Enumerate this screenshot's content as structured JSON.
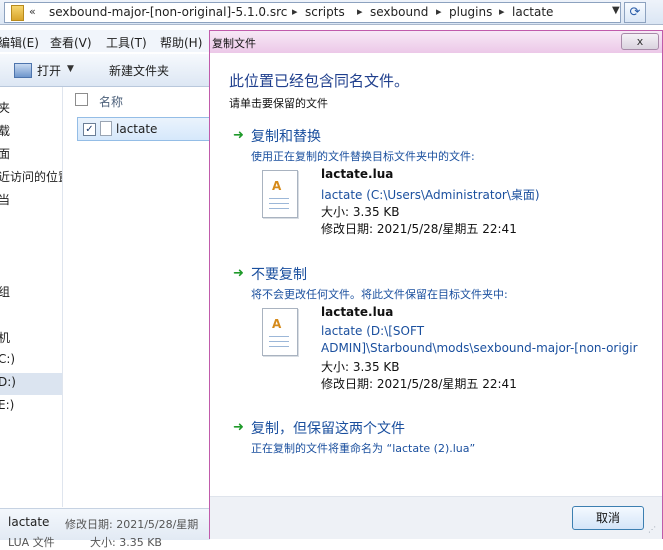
{
  "explorer": {
    "breadcrumbs": [
      "sexbound-major-[non-original]-5.1.0.src",
      "scripts",
      "sexbound",
      "plugins",
      "lactate"
    ],
    "menu": [
      "编辑(E)",
      "查看(V)",
      "工具(T)",
      "帮助(H)"
    ],
    "toolbar": {
      "open_label": "打开",
      "new_folder_label": "新建文件夹"
    },
    "nav_items": [
      "夹",
      "载",
      "面",
      "近访问的位置",
      "当",
      "",
      "",
      "",
      "组",
      "",
      "机",
      "C:)",
      "D:)",
      "E:)"
    ],
    "list_header": "名称",
    "file_row": {
      "name": "lactate",
      "checked": true
    },
    "details": {
      "name": "lactate",
      "date": "修改日期: 2021/5/28/星期",
      "type": "LUA 文件",
      "size": "大小: 3.35 KB"
    }
  },
  "dialog": {
    "title": "复制文件",
    "heading": "此位置已经包含同名文件。",
    "subheading": "请单击要保留的文件",
    "options": [
      {
        "title": "复制和替换",
        "desc": "使用正在复制的文件替换目标文件夹中的文件:",
        "file": {
          "name": "lactate.lua",
          "path1": "lactate (C:\\Users\\Administrator\\桌面)",
          "path2": "",
          "size": "大小: 3.35 KB",
          "date": "修改日期: 2021/5/28/星期五 22:41"
        }
      },
      {
        "title": "不要复制",
        "desc": "将不会更改任何文件。将此文件保留在目标文件夹中:",
        "file": {
          "name": "lactate.lua",
          "path1": "lactate (D:\\[SOFT",
          "path2": "ADMIN]\\Starbound\\mods\\sexbound-major-[non-origir",
          "size": "大小: 3.35 KB",
          "date": "修改日期: 2021/5/28/星期五 22:41"
        }
      },
      {
        "title": "复制，但保留这两个文件",
        "desc": "正在复制的文件将重命名为 “lactate (2).lua”"
      }
    ],
    "cancel_label": "取消",
    "close_label": "x"
  }
}
